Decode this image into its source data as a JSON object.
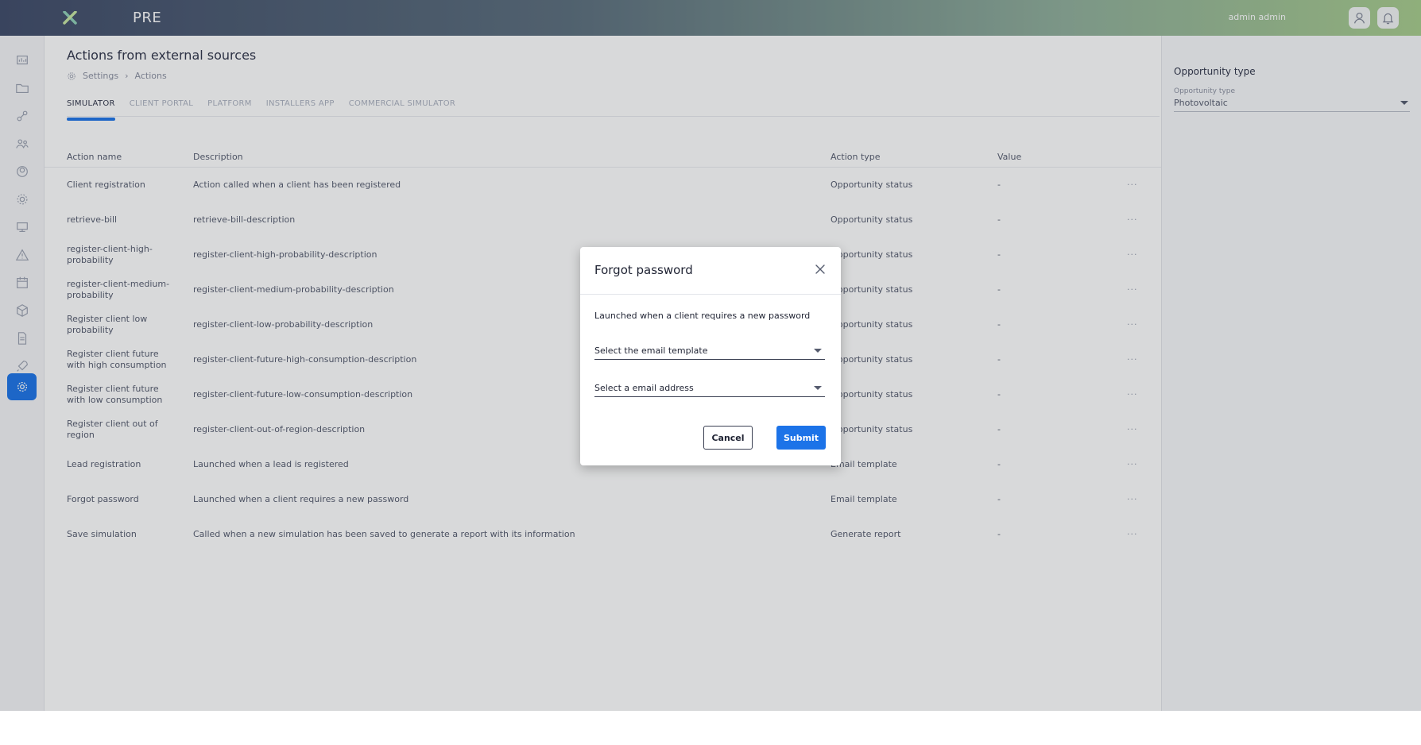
{
  "topbar": {
    "brand": "PRE",
    "user_name": "admin admin",
    "user_icon": "user-icon",
    "bell_icon": "bell-icon"
  },
  "sidebar": {
    "items": [
      {
        "icon": "dashboard-icon"
      },
      {
        "icon": "folder-icon"
      },
      {
        "icon": "pipeline-icon"
      },
      {
        "icon": "team-icon"
      },
      {
        "icon": "users-icon"
      },
      {
        "icon": "gear-cog-icon"
      },
      {
        "icon": "monitor-icon"
      },
      {
        "icon": "alert-icon"
      },
      {
        "icon": "calendar-icon"
      },
      {
        "icon": "box-icon"
      },
      {
        "icon": "document-icon"
      },
      {
        "icon": "rocket-icon"
      },
      {
        "icon": "settings-icon",
        "active": true
      }
    ]
  },
  "main": {
    "title": "Actions from external sources",
    "breadcrumb": [
      "Settings",
      "Actions"
    ],
    "breadcrumb_sep": "›",
    "tabs": [
      {
        "label": "SIMULATOR",
        "active": true
      },
      {
        "label": "CLIENT PORTAL"
      },
      {
        "label": "PLATFORM"
      },
      {
        "label": "INSTALLERS APP"
      },
      {
        "label": "COMMERCIAL SIMULATOR"
      }
    ],
    "columns": {
      "name": "Action name",
      "description": "Description",
      "type": "Action type",
      "value": "Value"
    },
    "rows": [
      {
        "name": "Client registration",
        "description": "Action called when a client has been registered",
        "type": "Opportunity status",
        "value": "-",
        "more": "···"
      },
      {
        "name": "retrieve-bill",
        "description": "retrieve-bill-description",
        "type": "Opportunity status",
        "value": "-",
        "more": "···"
      },
      {
        "name": "register-client-high-probability",
        "description": "register-client-high-probability-description",
        "type": "Opportunity status",
        "value": "-",
        "more": "···"
      },
      {
        "name": "register-client-medium-probability",
        "description": "register-client-medium-probability-description",
        "type": "Opportunity status",
        "value": "-",
        "more": "···"
      },
      {
        "name": "Register client low probability",
        "description": "register-client-low-probability-description",
        "type": "Opportunity status",
        "value": "-",
        "more": "···"
      },
      {
        "name": "Register client future with high consumption",
        "description": "register-client-future-high-consumption-description",
        "type": "Opportunity status",
        "value": "-",
        "more": "···"
      },
      {
        "name": "Register client future with low consumption",
        "description": "register-client-future-low-consumption-description",
        "type": "Opportunity status",
        "value": "-",
        "more": "···"
      },
      {
        "name": "Register client out of region",
        "description": "register-client-out-of-region-description",
        "type": "Opportunity status",
        "value": "-",
        "more": "···"
      },
      {
        "name": "Lead registration",
        "description": "Launched when a lead is registered",
        "type": "Email template",
        "value": "-",
        "more": "···"
      },
      {
        "name": "Forgot password",
        "description": "Launched when a client requires a new password",
        "type": "Email template",
        "value": "-",
        "more": "···"
      },
      {
        "name": "Save simulation",
        "description": "Called when a new simulation has been saved to generate a report with its information",
        "type": "Generate report",
        "value": "-",
        "more": "···"
      }
    ]
  },
  "right_panel": {
    "title": "Opportunity type",
    "field_label": "Opportunity type",
    "field_value": "Photovoltaic"
  },
  "modal": {
    "title": "Forgot password",
    "description": "Launched when a client requires a new password",
    "template_placeholder": "Select the email template",
    "email_placeholder": "Select a email address",
    "cancel_label": "Cancel",
    "submit_label": "Submit"
  },
  "colors": {
    "accent": "#1c73e8",
    "overlay": "rgba(40,42,48,0.18)"
  }
}
